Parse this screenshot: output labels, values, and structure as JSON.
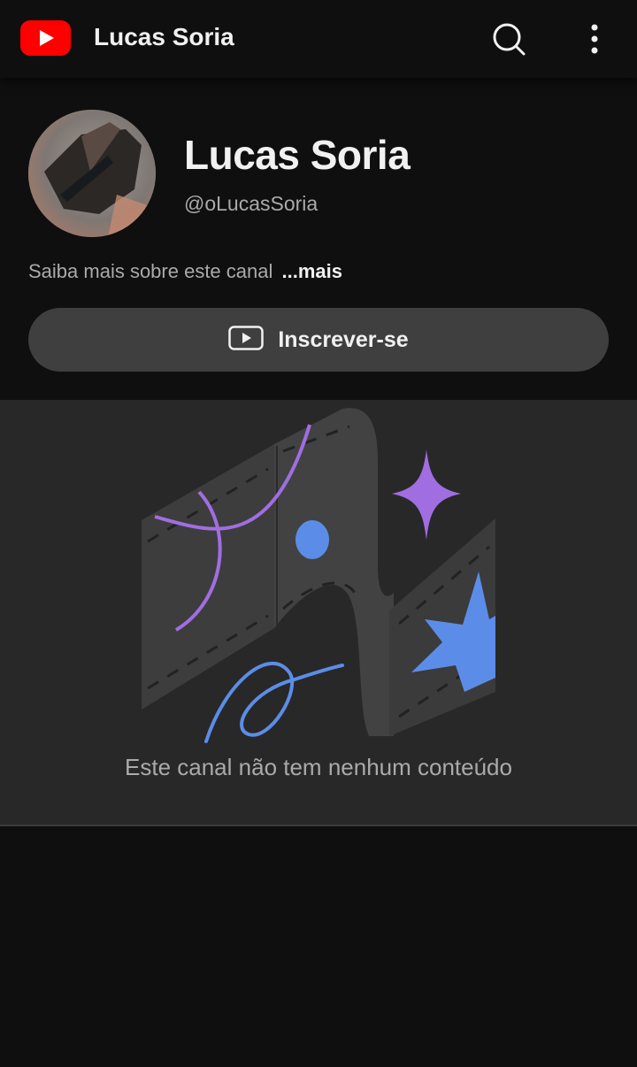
{
  "topbar": {
    "logo_icon": "youtube-logo-icon",
    "title": "Lucas Soria",
    "search_icon": "search-icon",
    "more_icon": "more-vert-icon"
  },
  "channel": {
    "name": "Lucas Soria",
    "handle": "@oLucasSoria",
    "about_text": "Saiba mais sobre este canal",
    "about_more": "...mais"
  },
  "subscribe": {
    "icon": "play-box-icon",
    "label": "Inscrever-se"
  },
  "empty_state": {
    "message": "Este canal não tem nenhum conteúdo"
  },
  "colors": {
    "brand_red": "#ff0000",
    "accent_purple": "#a06ee1",
    "accent_blue": "#5b8de8",
    "background": "#0f0f0f",
    "panel": "#282828"
  }
}
